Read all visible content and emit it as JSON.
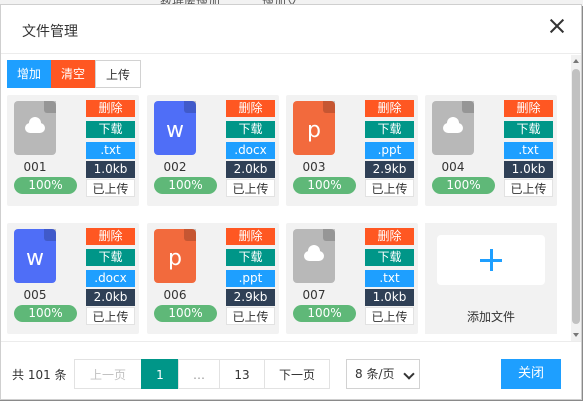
{
  "background": {
    "peek_text_left": "数据库增加",
    "peek_text_right": "增加文"
  },
  "dialog": {
    "title": "文件管理",
    "close_icon": "close-icon"
  },
  "toolbar": {
    "add_label": "增加",
    "clear_label": "清空",
    "upload_label": "上传"
  },
  "actions": {
    "delete_label": "删除",
    "download_label": "下载"
  },
  "files": [
    {
      "name": "001",
      "type": "generic",
      "ext": ".txt",
      "size": "1.0kb",
      "progress": "100%",
      "status": "已上传",
      "color": "#b8b8b8"
    },
    {
      "name": "002",
      "type": "word",
      "ext": ".docx",
      "size": "2.0kb",
      "progress": "100%",
      "status": "已上传",
      "color": "#4f6ef7"
    },
    {
      "name": "003",
      "type": "ppt",
      "ext": ".ppt",
      "size": "2.9kb",
      "progress": "100%",
      "status": "已上传",
      "color": "#f26a3d"
    },
    {
      "name": "004",
      "type": "generic",
      "ext": ".txt",
      "size": "1.0kb",
      "progress": "100%",
      "status": "已上传",
      "color": "#b8b8b8"
    },
    {
      "name": "005",
      "type": "word",
      "ext": ".docx",
      "size": "2.0kb",
      "progress": "100%",
      "status": "已上传",
      "color": "#4f6ef7"
    },
    {
      "name": "006",
      "type": "ppt",
      "ext": ".ppt",
      "size": "2.9kb",
      "progress": "100%",
      "status": "已上传",
      "color": "#f26a3d"
    },
    {
      "name": "007",
      "type": "generic",
      "ext": ".txt",
      "size": "1.0kb",
      "progress": "100%",
      "status": "已上传",
      "color": "#b8b8b8"
    }
  ],
  "add_file": {
    "label": "添加文件"
  },
  "pagination": {
    "total_text": "共 101 条",
    "prev_label": "上一页",
    "current_page": "1",
    "ellipsis": "…",
    "last_page": "13",
    "next_label": "下一页",
    "page_size_selected": "8 条/页"
  },
  "footer": {
    "close_label": "关闭"
  },
  "colors": {
    "primary": "#1e9fff",
    "danger": "#ff5722",
    "teal": "#009688",
    "dark": "#2f4056",
    "success": "#5fb878"
  }
}
